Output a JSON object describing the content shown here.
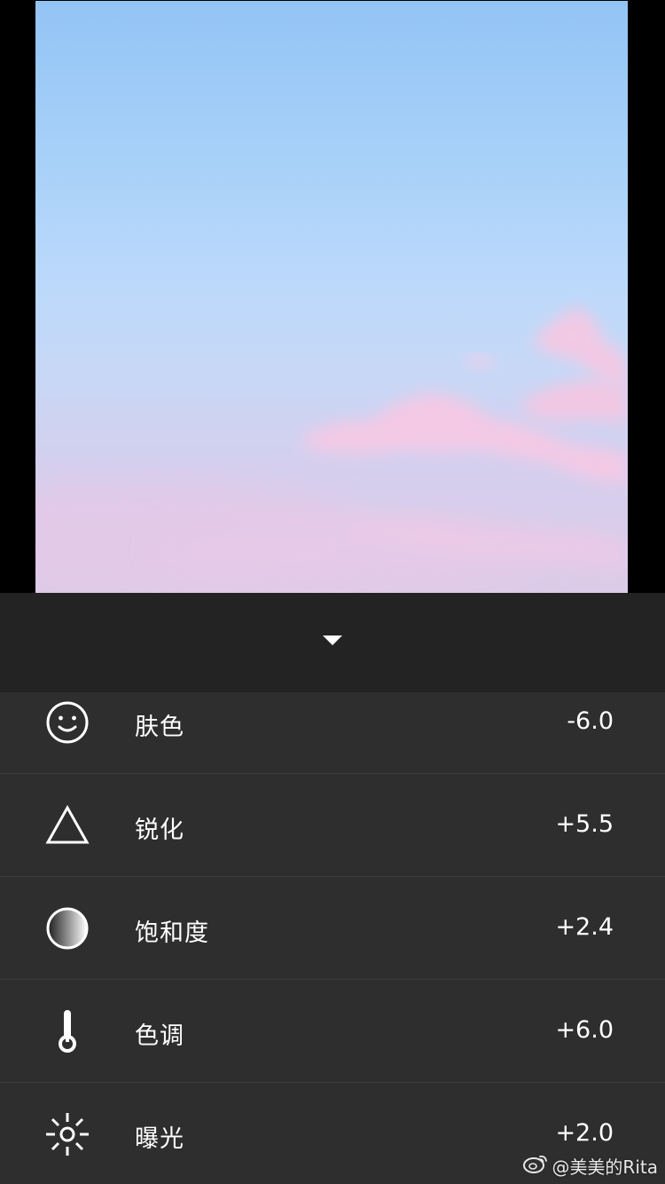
{
  "colors": {
    "panel_header_bg": "#232323",
    "list_bg": "#2e2e2e",
    "divider": "#3c3c3c",
    "text": "#ffffff",
    "sky_top": "#93c4f5",
    "cloud_pink": "#f3cbe6"
  },
  "header": {
    "collapse_icon": "caret-down-icon"
  },
  "adjustments": [
    {
      "icon": "smiley-face-icon",
      "label": "肤色",
      "value": "-6.0"
    },
    {
      "icon": "triangle-icon",
      "label": "锐化",
      "value": "+5.5"
    },
    {
      "icon": "gradient-circle-icon",
      "label": "饱和度",
      "value": "+2.4"
    },
    {
      "icon": "thermometer-icon",
      "label": "色调",
      "value": "+6.0"
    },
    {
      "icon": "sun-icon",
      "label": "曝光",
      "value": "+2.0"
    }
  ],
  "watermark": {
    "icon": "weibo-logo-icon",
    "text": "@美美的Rita"
  }
}
